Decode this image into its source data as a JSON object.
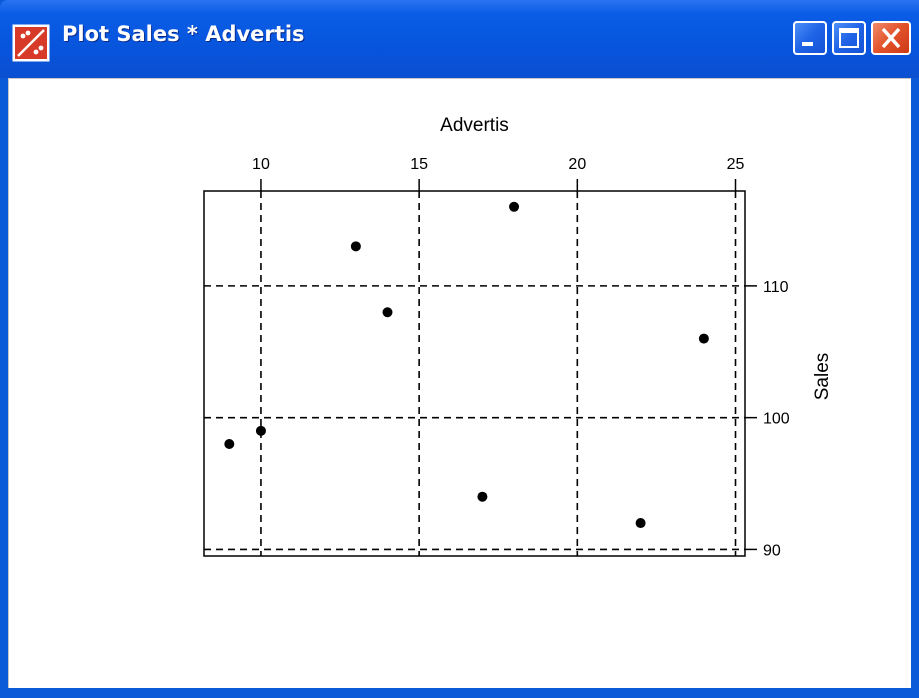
{
  "window": {
    "title": "Plot Sales * Advertis",
    "controls": {
      "minimize_icon": "minimize-icon",
      "maximize_icon": "maximize-icon",
      "close_icon": "close-icon"
    },
    "colors": {
      "titlebar": "#0a5ce6",
      "close_button": "#e2522a",
      "plot_background": "#ffffff",
      "points": "#000000"
    }
  },
  "chart_data": {
    "type": "scatter",
    "xlabel": "Advertis",
    "ylabel": "Sales",
    "x_axis_position": "top",
    "y_axis_position": "right",
    "xlim": [
      8.2,
      25.3
    ],
    "ylim": [
      89.5,
      117.2
    ],
    "xticks": [
      10,
      15,
      20,
      25
    ],
    "yticks": [
      90,
      100,
      110
    ],
    "grid": true,
    "grid_style": "dashed",
    "points": [
      {
        "x": 9,
        "y": 98
      },
      {
        "x": 10,
        "y": 99
      },
      {
        "x": 13,
        "y": 113
      },
      {
        "x": 14,
        "y": 108
      },
      {
        "x": 17,
        "y": 94
      },
      {
        "x": 18,
        "y": 116
      },
      {
        "x": 22,
        "y": 92
      },
      {
        "x": 24,
        "y": 106
      }
    ]
  }
}
